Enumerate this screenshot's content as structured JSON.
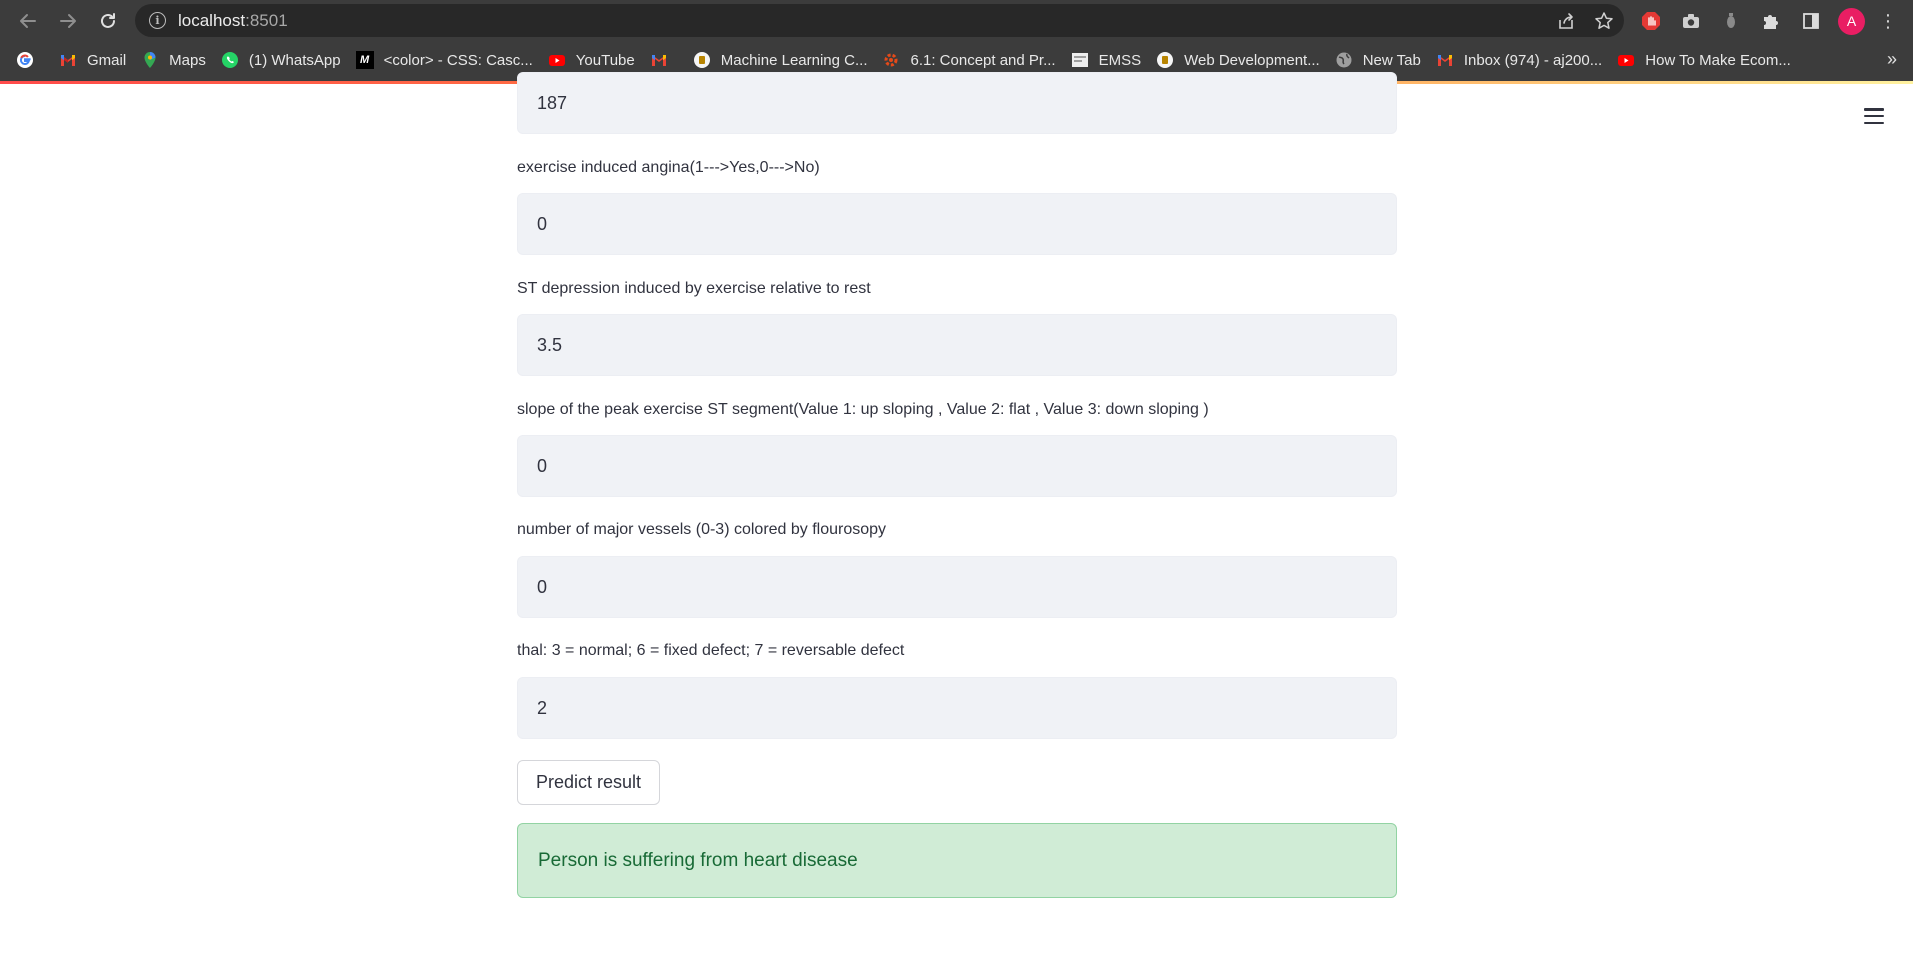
{
  "browser": {
    "url_host": "localhost",
    "url_port": ":8501",
    "profile_initial": "A",
    "bookmarks": [
      {
        "label": "Gmail",
        "icon": "gmail-icon"
      },
      {
        "label": "Maps",
        "icon": "maps-icon"
      },
      {
        "label": "(1) WhatsApp",
        "icon": "whatsapp-icon"
      },
      {
        "label": "<color> - CSS: Casc...",
        "icon": "mdn-icon"
      },
      {
        "label": "YouTube",
        "icon": "youtube-icon"
      },
      {
        "label": "",
        "icon": "gmail-icon"
      },
      {
        "label": "Machine Learning C...",
        "icon": "course-icon"
      },
      {
        "label": "6.1: Concept and Pr...",
        "icon": "gear-red-icon"
      },
      {
        "label": "EMSS",
        "icon": "page-icon"
      },
      {
        "label": "Web Development...",
        "icon": "course-icon"
      },
      {
        "label": "New Tab",
        "icon": "globe-icon"
      },
      {
        "label": "Inbox (974) - aj200...",
        "icon": "gmail-icon"
      },
      {
        "label": "How To Make Ecom...",
        "icon": "youtube-icon"
      }
    ],
    "more_bookmarks": "»"
  },
  "form": {
    "fields": [
      {
        "label": "",
        "value": "187"
      },
      {
        "label": "exercise induced angina(1--->Yes,0--->No)",
        "value": "0"
      },
      {
        "label": "ST depression induced by exercise relative to rest",
        "value": "3.5"
      },
      {
        "label": "slope of the peak exercise ST segment(Value 1: up sloping , Value 2: flat , Value 3: down sloping )",
        "value": "0"
      },
      {
        "label": "number of major vessels (0-3) colored by flourosopy",
        "value": "0"
      },
      {
        "label": "thal: 3 = normal; 6 = fixed defect; 7 = reversable defect",
        "value": "2"
      }
    ],
    "predict_label": "Predict result"
  },
  "result": {
    "message": "Person is suffering from heart disease"
  },
  "colors": {
    "accent": "#ff4b4b",
    "input_bg": "#f0f2f6",
    "success_bg": "#d0ecd6",
    "success_text": "#186a36"
  }
}
